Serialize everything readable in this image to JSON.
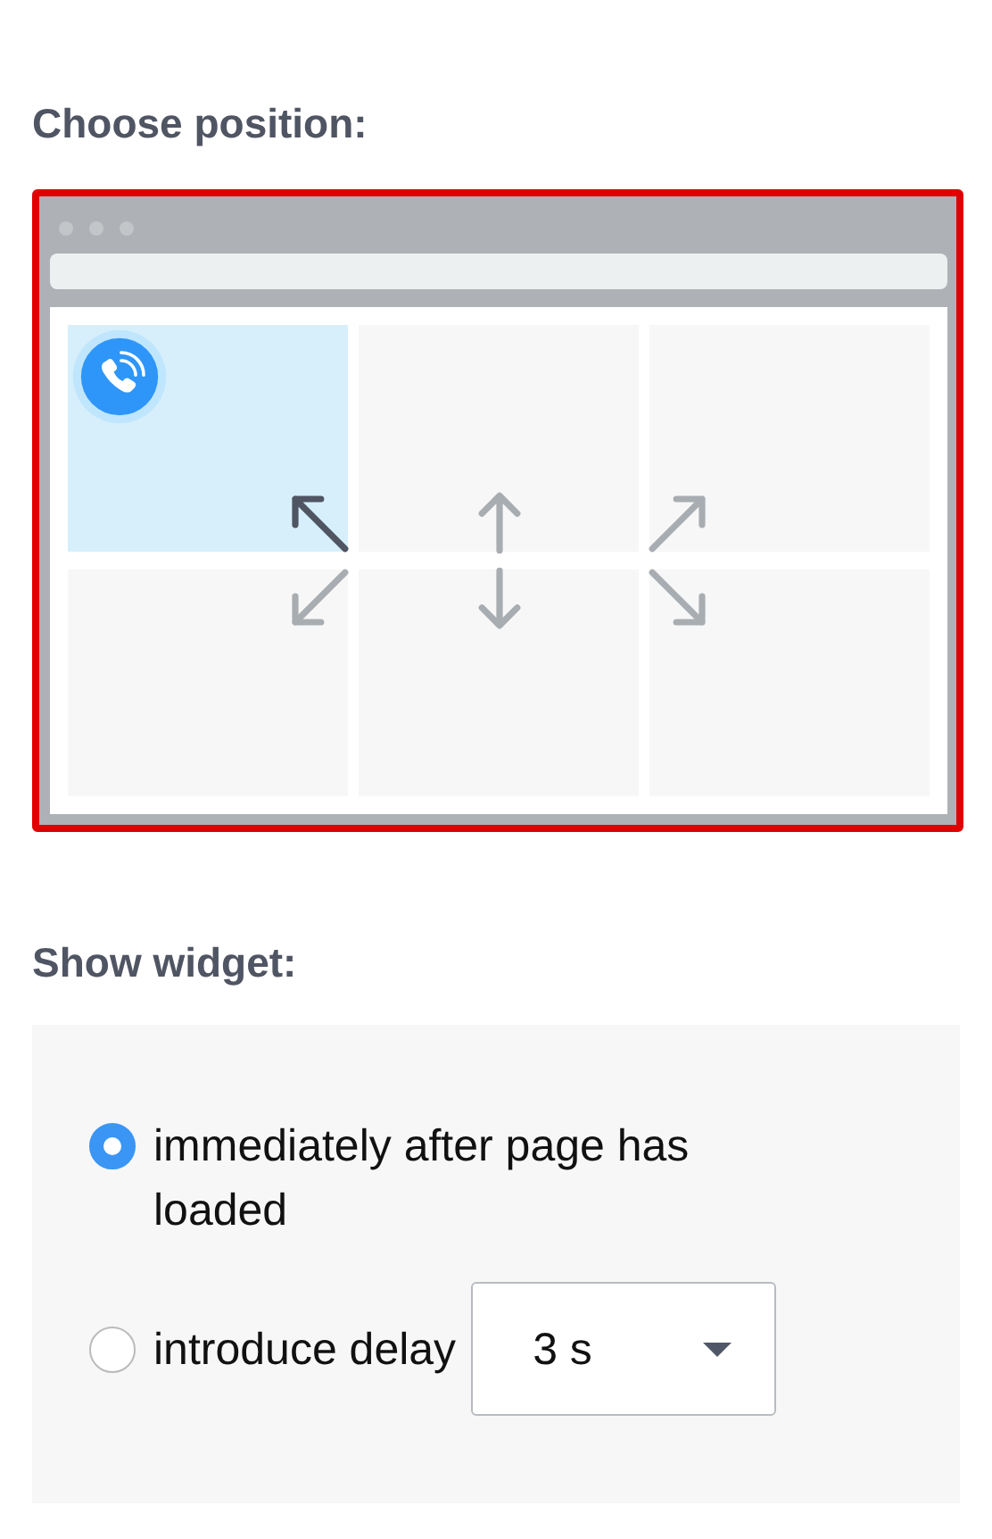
{
  "position_heading": "Choose position:",
  "positions": [
    {
      "kind": "nw",
      "selected": true
    },
    {
      "kind": "n",
      "selected": false
    },
    {
      "kind": "ne",
      "selected": false
    },
    {
      "kind": "sw",
      "selected": false
    },
    {
      "kind": "s",
      "selected": false
    },
    {
      "kind": "se",
      "selected": false
    }
  ],
  "show_heading": "Show widget:",
  "options": [
    {
      "label": "immediately after page has loaded",
      "selected": true
    },
    {
      "label": "introduce delay",
      "selected": false,
      "delay": {
        "value": "3 s"
      }
    }
  ]
}
